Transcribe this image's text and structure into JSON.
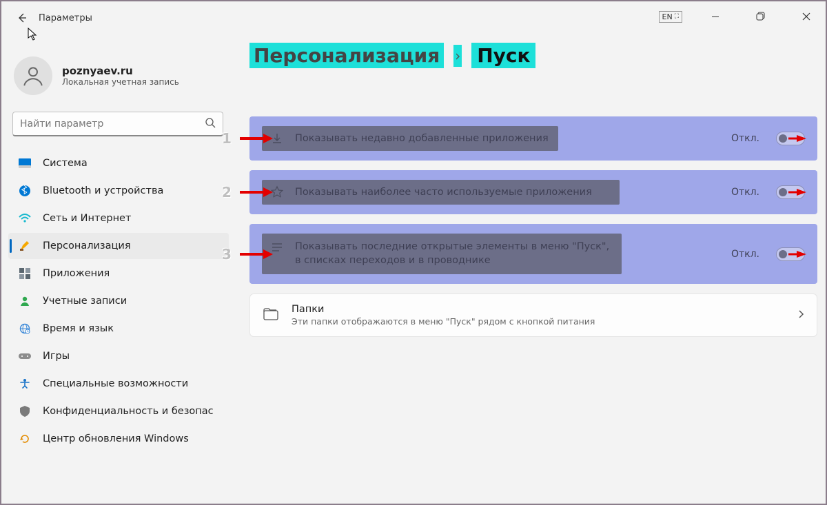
{
  "window": {
    "title": "Параметры",
    "lang_badge": "EN"
  },
  "user": {
    "name": "poznyaev.ru",
    "subtitle": "Локальная учетная запись"
  },
  "search": {
    "placeholder": "Найти параметр"
  },
  "nav": {
    "items": [
      {
        "label": "Система"
      },
      {
        "label": "Bluetooth и устройства"
      },
      {
        "label": "Сеть и Интернет"
      },
      {
        "label": "Персонализация"
      },
      {
        "label": "Приложения"
      },
      {
        "label": "Учетные записи"
      },
      {
        "label": "Время и язык"
      },
      {
        "label": "Игры"
      },
      {
        "label": "Специальные возможности"
      },
      {
        "label": "Конфиденциальность и безопас"
      },
      {
        "label": "Центр обновления Windows"
      }
    ],
    "active_index": 3
  },
  "breadcrumb": {
    "parent": "Персонализация",
    "separator": "›",
    "current": "Пуск"
  },
  "settings": [
    {
      "num": "1",
      "label": "Показывать недавно добавленные приложения",
      "state": "Откл."
    },
    {
      "num": "2",
      "label": "Показывать наиболее часто используемые приложения",
      "state": "Откл."
    },
    {
      "num": "3",
      "label": "Показывать последние открытые элементы в меню \"Пуск\", в списках переходов и в проводнике",
      "state": "Откл."
    }
  ],
  "folders": {
    "title": "Папки",
    "subtitle": "Эти папки отображаются в меню \"Пуск\" рядом с кнопкой питания"
  }
}
